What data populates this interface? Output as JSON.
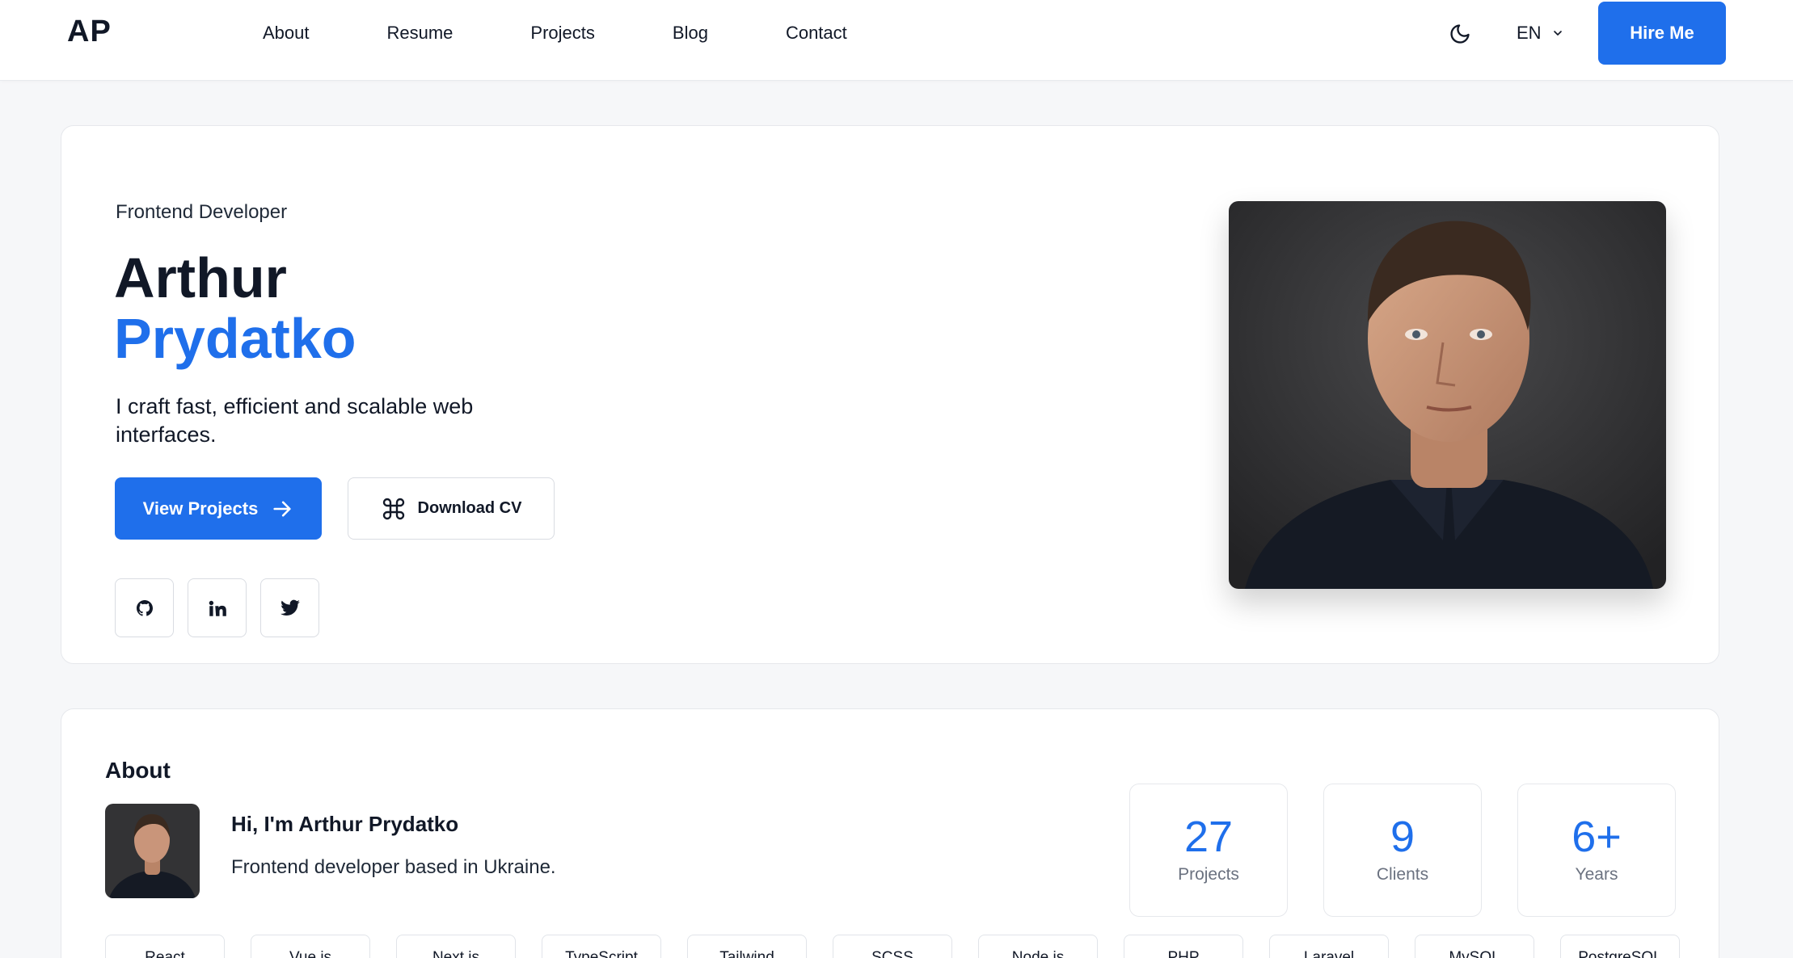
{
  "header": {
    "logo": "AP",
    "nav": [
      "About",
      "Resume",
      "Projects",
      "Blog",
      "Contact"
    ],
    "language": "EN",
    "hire_label": "Hire Me"
  },
  "hero": {
    "role": "Frontend Developer",
    "first_name": "Arthur",
    "last_name": "Prydatko",
    "tagline": "I craft fast, efficient and scalable web interfaces.",
    "view_projects_label": "View Projects",
    "download_cv_label": "Download CV",
    "socials": [
      "github-icon",
      "linkedin-icon",
      "twitter-icon"
    ]
  },
  "about": {
    "title": "About",
    "greeting": "Hi, I'm Arthur Prydatko",
    "bio": "Frontend developer based in Ukraine.",
    "stats": [
      {
        "value": "27",
        "label": "Projects"
      },
      {
        "value": "9",
        "label": "Clients"
      },
      {
        "value": "6+",
        "label": "Years"
      }
    ],
    "skills": [
      "React",
      "Vue.js",
      "Next.js",
      "TypeScript",
      "Tailwind",
      "SCSS",
      "Node.js",
      "PHP",
      "Laravel",
      "MySQL",
      "PostgreSQL"
    ]
  },
  "colors": {
    "accent": "#1f6feb",
    "text": "#111827",
    "background": "#f6f7f9"
  }
}
